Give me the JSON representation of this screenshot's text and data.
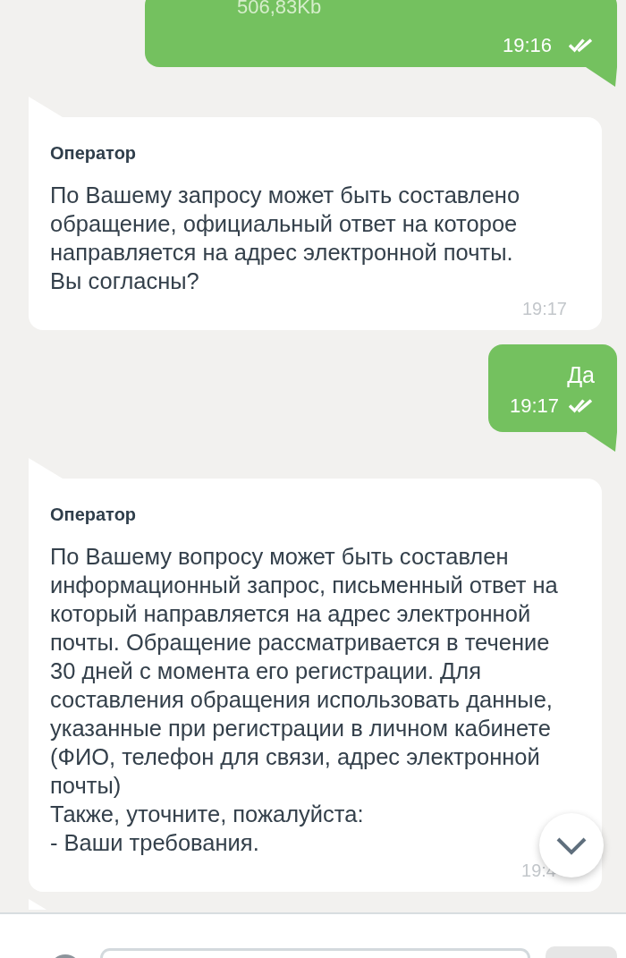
{
  "messages": [
    {
      "kind": "outgoing",
      "file_size": "506,83Kb",
      "time": "19:16",
      "read": true
    },
    {
      "kind": "incoming",
      "sender": "Оператор",
      "paragraphs": [
        "По Вашему запросу может быть составлено обращение, официальный ответ на которое направляется на адрес электронной почты.",
        "Вы согласны?"
      ],
      "time": "19:17"
    },
    {
      "kind": "outgoing",
      "text": "Да",
      "time": "19:17",
      "read": true
    },
    {
      "kind": "incoming",
      "sender": "Оператор",
      "paragraphs": [
        "По Вашему вопросу может быть составлен информационный запрос, письменный ответ на который направляется на адрес электронной почты. Обращение рассматривается в течение 30 дней с момента его регистрации. Для составления обращения использовать данные, указанные при регистрации в личном кабинете (ФИО, телефон для связи, адрес электронной почты)",
        "Также, уточните, пожалуйста:",
        "- Ваши требования."
      ],
      "time": "19:4"
    }
  ]
}
